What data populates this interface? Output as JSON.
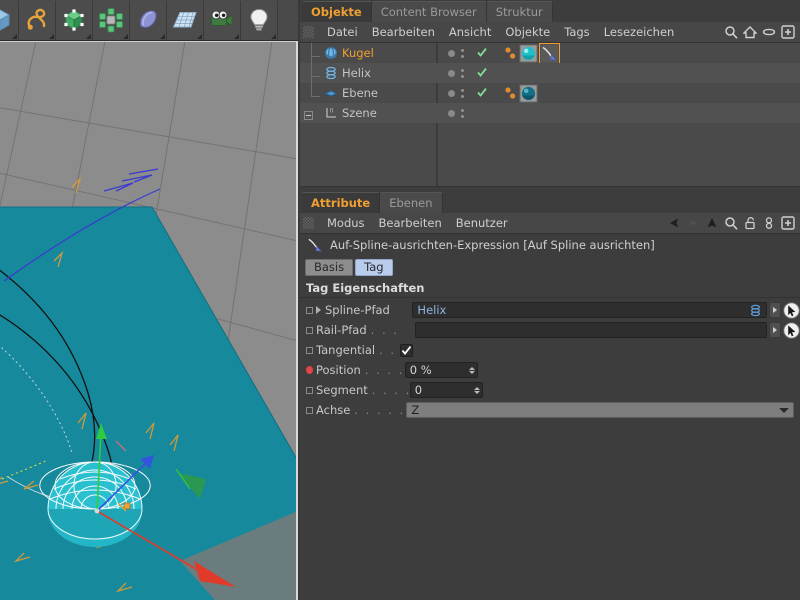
{
  "toolbar": {
    "buttons": [
      {
        "name": "cube-primitive-tool",
        "icon": "cube-blue-icon"
      },
      {
        "name": "spline-tool",
        "icon": "spline-curve-icon"
      },
      {
        "name": "nurbs-generator-tool",
        "icon": "subdivision-cube-icon"
      },
      {
        "name": "array-modeling-tool",
        "icon": "array-cluster-icon"
      },
      {
        "name": "deformer-tool",
        "icon": "bend-deformer-icon"
      },
      {
        "name": "scene-object-tool",
        "icon": "floor-grid-icon"
      },
      {
        "name": "camera-tool",
        "icon": "camera-icon"
      },
      {
        "name": "light-tool",
        "icon": "light-bulb-icon"
      }
    ]
  },
  "viewport": {
    "nav_buttons": [
      {
        "name": "viewport-move",
        "icon": "move-4way-icon"
      },
      {
        "name": "viewport-dolly",
        "icon": "dolly-arrow-icon"
      },
      {
        "name": "viewport-rotate",
        "icon": "rotate-circle-icon"
      },
      {
        "name": "viewport-maximize",
        "icon": "maximize-panel-icon"
      }
    ],
    "colors": {
      "grid_floor": "#8c8c8c",
      "plane_object": "#1a8a9e",
      "axis_x": "#e03b2a",
      "axis_y": "#2ecc40",
      "axis_z": "#3355dd",
      "spline_helix": "#1a1a1a",
      "selection_outline": "#ffffff"
    }
  },
  "object_manager": {
    "tabs": [
      {
        "label": "Objekte",
        "active": true
      },
      {
        "label": "Content Browser",
        "active": false
      },
      {
        "label": "Struktur",
        "active": false
      }
    ],
    "menus": [
      "Datei",
      "Bearbeiten",
      "Ansicht",
      "Objekte",
      "Tags",
      "Lesezeichen"
    ],
    "menu_icons": [
      {
        "name": "search-icon",
        "icon": "magnifier"
      },
      {
        "name": "home-icon",
        "icon": "house"
      },
      {
        "name": "visibility-icon",
        "icon": "eye-ellipse"
      },
      {
        "name": "add-layer-icon",
        "icon": "plus-box"
      }
    ],
    "rows": [
      {
        "label": "Kugel",
        "icon": "sphere-object-icon",
        "selected": true,
        "indent": 1,
        "check": true,
        "tags": [
          {
            "name": "material-tag",
            "icon": "material-sphere-teal"
          },
          {
            "name": "align-to-spline-tag",
            "icon": "spline-align-tag",
            "selected": true
          }
        ]
      },
      {
        "label": "Helix",
        "icon": "helix-object-icon",
        "selected": false,
        "indent": 1,
        "check": true,
        "tags": []
      },
      {
        "label": "Ebene",
        "icon": "plane-object-icon",
        "selected": false,
        "indent": 1,
        "check": true,
        "tags": [
          {
            "name": "material-tag",
            "icon": "material-sphere-dark"
          }
        ]
      },
      {
        "label": "Szene",
        "icon": "scene-root-icon",
        "selected": false,
        "indent": 0,
        "check": false,
        "tags": []
      }
    ]
  },
  "attribute_manager": {
    "tabs": [
      {
        "label": "Attribute",
        "active": true
      },
      {
        "label": "Ebenen",
        "active": false
      }
    ],
    "menus": [
      "Modus",
      "Bearbeiten",
      "Benutzer"
    ],
    "menu_icons": [
      {
        "name": "nav-back-icon",
        "icon": "arrow-left-solid"
      },
      {
        "name": "nav-forward-icon",
        "icon": "arrow-right-dim"
      },
      {
        "name": "nav-up-icon",
        "icon": "arrow-up-solid"
      },
      {
        "name": "search-icon",
        "icon": "magnifier"
      },
      {
        "name": "lock-icon",
        "icon": "padlock-open"
      },
      {
        "name": "link-icon",
        "icon": "chain-link"
      },
      {
        "name": "add-icon",
        "icon": "plus-box"
      }
    ],
    "object_title": "Auf-Spline-ausrichten-Expression [Auf Spline ausrichten]",
    "object_icon": "spline-align-tag",
    "mode_buttons": [
      {
        "label": "Basis",
        "active": false
      },
      {
        "label": "Tag",
        "active": true
      }
    ],
    "section_title": "Tag Eigenschaften",
    "properties": [
      {
        "name": "spline-path",
        "label": "Spline-Pfad",
        "dots": "",
        "type": "link",
        "value": "Helix",
        "expandable": true,
        "animated": false,
        "field_icon": "helix-object-icon"
      },
      {
        "name": "rail-path",
        "label": "Rail-Pfad",
        "dots": ". . .",
        "type": "link",
        "value": "",
        "expandable": false,
        "animated": false,
        "field_icon": ""
      },
      {
        "name": "tangential",
        "label": "Tangential",
        "dots": ". .",
        "type": "checkbox",
        "value": true,
        "expandable": false,
        "animated": false
      },
      {
        "name": "position",
        "label": "Position",
        "dots": ". . . .",
        "type": "number",
        "value": "0 %",
        "expandable": false,
        "animated": true
      },
      {
        "name": "segment",
        "label": "Segment",
        "dots": ". . . .",
        "type": "number",
        "value": "0",
        "expandable": false,
        "animated": false
      },
      {
        "name": "axis",
        "label": "Achse",
        "dots": ". . . . . . .",
        "type": "select",
        "value": "Z",
        "expandable": false,
        "animated": false
      }
    ]
  },
  "colors": {
    "accent_orange": "#f0a030",
    "panel_bg": "#3d3d3d",
    "toolbar_bg": "#4a4a4a",
    "field_bg": "#2e2e2e",
    "link_text": "#8fb4e0",
    "keyframe_red": "#e04545"
  }
}
